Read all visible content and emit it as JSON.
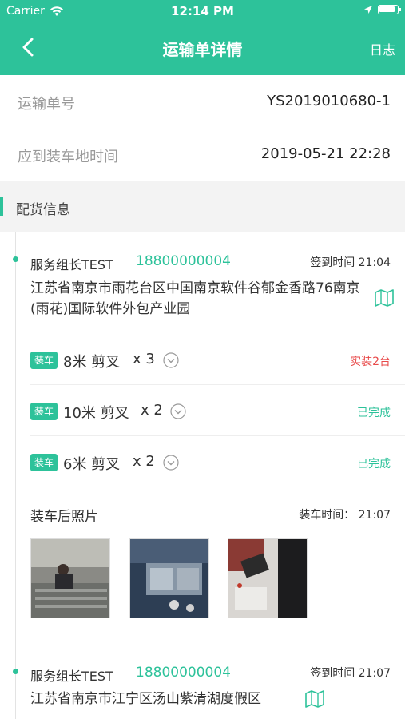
{
  "status_bar": {
    "carrier": "Carrier",
    "time": "12:14 PM",
    "battery_level": 0.9
  },
  "nav": {
    "title": "运输单详情",
    "log_label": "日志",
    "back_icon": "chevron-left-icon"
  },
  "order": {
    "number_label": "运输单号",
    "number_value": "YS2019010680-1",
    "time_label": "应到装车地时间",
    "time_value": "2019-05-21 22:28"
  },
  "section": {
    "title": "配货信息"
  },
  "colors": {
    "accent": "#2dc29a",
    "warning": "#e84a4a"
  },
  "stops": [
    {
      "name": "服务组长TEST",
      "phone": "18800000004",
      "sign_time": "签到时间 21:04",
      "address": "江苏省南京市雨花台区中国南京软件谷郁金香路76南京(雨花)国际软件外包产业园",
      "items": [
        {
          "tag": "装车",
          "name": "8米 剪叉",
          "qty": "x 3",
          "status": "实装2台"
        },
        {
          "tag": "装车",
          "name": "10米 剪叉",
          "qty": "x 2",
          "status": "已完成"
        },
        {
          "tag": "装车",
          "name": "6米 剪叉",
          "qty": "x 2",
          "status": "已完成"
        }
      ],
      "photos_title": "装车后照片",
      "photos_time": "装车时间：  21:07"
    },
    {
      "name": "服务组长TEST",
      "phone": "18800000004",
      "sign_time": "签到时间 21:07",
      "address": "江苏省南京市江宁区汤山紫清湖度假区"
    }
  ]
}
